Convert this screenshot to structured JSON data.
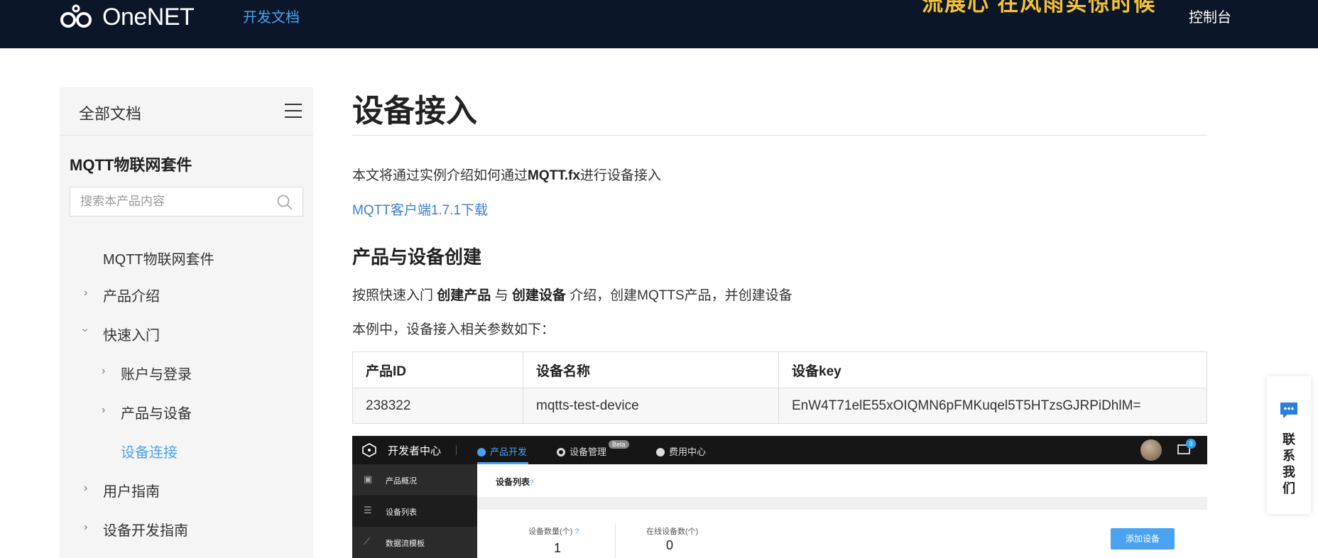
{
  "topbar": {
    "logo_text": "OneNET",
    "nav_docs": "开发文档",
    "banner_partial": "流展心 在风雨实惊时候",
    "nav_console": "控制台",
    "colors": {
      "bg": "#0b1628",
      "link": "#4aa3f0",
      "banner": "#f4c235"
    }
  },
  "sidebar": {
    "title": "全部文档",
    "product": "MQTT物联网套件",
    "search_placeholder": "搜索本产品内容",
    "items": [
      {
        "label": "MQTT物联网套件",
        "icon": ""
      },
      {
        "label": "产品介绍",
        "icon": "chevron-right-icon"
      },
      {
        "label": "快速入门",
        "icon": "chevron-down-icon"
      },
      {
        "label": "账户与登录",
        "icon": "chevron-right-icon"
      },
      {
        "label": "产品与设备",
        "icon": "chevron-right-icon"
      },
      {
        "label": "设备连接",
        "icon": "",
        "active": true
      },
      {
        "label": "用户指南",
        "icon": "chevron-right-icon"
      },
      {
        "label": "设备开发指南",
        "icon": "chevron-right-icon"
      }
    ]
  },
  "main": {
    "title": "设备接入",
    "intro_prefix": "本文将通过实例介绍如何通过",
    "intro_bold": "MQTT.fx",
    "intro_suffix": "进行设备接入",
    "download_link": "MQTT客户端1.7.1下载",
    "section_title": "产品与设备创建",
    "p2_a": "按照快速入门 ",
    "p2_b": "创建产品",
    "p2_c": " 与 ",
    "p2_d": "创建设备",
    "p2_e": " 介绍，创建MQTTS产品，并创建设备",
    "p3": "本例中，设备接入相关参数如下：",
    "table": {
      "headers": [
        "产品ID",
        "设备名称",
        "设备key"
      ],
      "rows": [
        [
          "238322",
          "mqtts-test-device",
          "EnW4T71elE55xOIQMN6pFMKuqel5T5HTzsGJRPiDhlM="
        ]
      ]
    }
  },
  "screenshot": {
    "brand": "开发者中心",
    "tabs": [
      "产品开发",
      "设备管理",
      "费用中心"
    ],
    "beta": "Beta",
    "mail_count": "3",
    "side_items": [
      "产品概况",
      "设备列表",
      "数据流模板"
    ],
    "crumb": "设备列表",
    "crumb_q": "?",
    "stat1_label": "设备数量(个)",
    "stat1_q": "?",
    "stat1_value": "1",
    "stat2_label": "在线设备数(个)",
    "stat2_value": "0",
    "add_button": "添加设备"
  },
  "contact": {
    "label": "联系我们"
  }
}
